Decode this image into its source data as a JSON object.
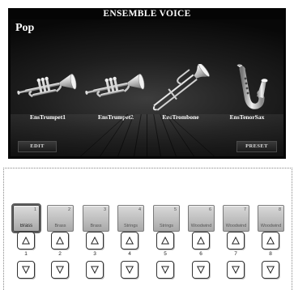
{
  "screen": {
    "title": "ENSEMBLE VOICE",
    "genre": "Pop",
    "instruments": [
      {
        "name": "EnsTrumpet1",
        "icon": "trumpet-icon"
      },
      {
        "name": "EnsTrumpet2",
        "icon": "trumpet-icon"
      },
      {
        "name": "EnsTrombone",
        "icon": "trombone-icon"
      },
      {
        "name": "EnsTenorSax",
        "icon": "saxophone-icon"
      }
    ],
    "edit_label": "EDIT",
    "preset_label": "PRESET"
  },
  "panel": {
    "pads": [
      {
        "number": "1",
        "label": "Brass"
      },
      {
        "number": "2",
        "label": "Brass"
      },
      {
        "number": "3",
        "label": "Brass"
      },
      {
        "number": "4",
        "label": "Strings"
      },
      {
        "number": "5",
        "label": "Strings"
      },
      {
        "number": "6",
        "label": "Woodwind"
      },
      {
        "number": "7",
        "label": "Woodwind"
      },
      {
        "number": "8",
        "label": "Woodwind"
      }
    ],
    "columns": [
      "1",
      "2",
      "3",
      "4",
      "5",
      "6",
      "7",
      "8"
    ],
    "up_icon": "triangle-up-icon",
    "down_icon": "triangle-down-icon"
  }
}
